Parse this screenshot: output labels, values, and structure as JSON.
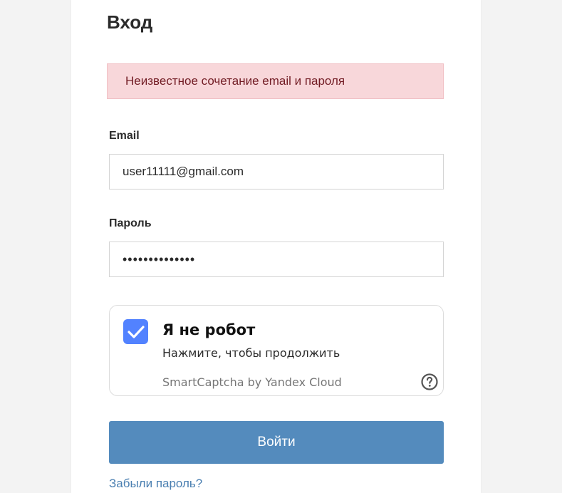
{
  "page": {
    "title": "Вход"
  },
  "alert": {
    "message": "Неизвестное сочетание email и пароля"
  },
  "form": {
    "email_label": "Email",
    "email_value": "user11111@gmail.com",
    "password_label": "Пароль",
    "password_value": "••••••••••••••"
  },
  "captcha": {
    "checked": true,
    "title": "Я не робот",
    "subtitle": "Нажмите, чтобы продолжить",
    "brand": "SmartCaptcha by Yandex Cloud",
    "check_icon": "checkmark-icon",
    "help_icon": "question-circle-icon"
  },
  "actions": {
    "submit_label": "Войти",
    "forgot_label": "Забыли пароль?"
  },
  "colors": {
    "background": "#f3f3f3",
    "card": "#ffffff",
    "alert_bg": "#f8d7da",
    "alert_text": "#721c24",
    "captcha_accent": "#5282ff",
    "submit_bg": "#548bbd",
    "link": "#4a7fb1"
  }
}
